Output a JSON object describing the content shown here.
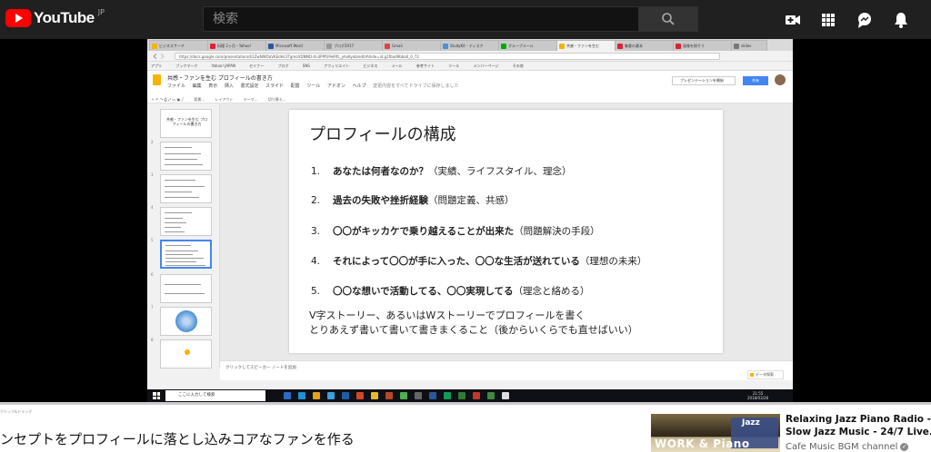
{
  "youtube": {
    "logo_text": "YouTube",
    "region": "JP",
    "search_placeholder": "検索"
  },
  "browser": {
    "tabs": [
      "ビジネスサーチ",
      "料理 2ヶ月・Yahoo!",
      "Microsoft Word",
      "ブログ2017",
      "Gmail",
      "StudyKit - ディスク",
      "グループメール",
      "共感・ファンを生む",
      "集客の基本",
      "画像を探そう",
      "slides"
    ],
    "active_tab": 7,
    "url": "https://docs.google.com/presentation/d/1ZwNWOaVKEdHc3TgmoXDNMD-Xn3PPfUPeIRfL_yhoKyob/edit#slide=id.g1fbad9bba0_0_72",
    "bookmarks": [
      "アプリ",
      "ブックマーク",
      "Yahoo! JAPAN",
      "セミナー",
      "ブログ",
      "SNS",
      "アフィリエイト",
      "ビジネス",
      "メール",
      "参考サイト",
      "ツール",
      "メンバーページ",
      "その他"
    ]
  },
  "doc": {
    "title": "共感・ファンを生む プロフィールの書き方",
    "menu": [
      "ファイル",
      "編集",
      "表示",
      "挿入",
      "書式設定",
      "スライド",
      "配置",
      "ツール",
      "アドオン",
      "ヘルプ"
    ],
    "saved_status": "変更内容をすべてドライブに保存しました",
    "present_label": "プレゼンテーションを開始",
    "share_label": "共有",
    "toolbar": [
      "背景...",
      "レイアウト",
      "テーマ...",
      "切り替え..."
    ]
  },
  "slide": {
    "title": "プロフィールの構成",
    "items": [
      {
        "num": "1.",
        "bold": "あなたは何者なのか？",
        "rest": "（実績、ライフスタイル、理念）"
      },
      {
        "num": "2.",
        "bold": "過去の失敗や挫折経験",
        "rest": "（問題定義、共感）"
      },
      {
        "num": "3.",
        "bold": "〇〇がキッカケで乗り越えることが出来た",
        "rest": "（問題解決の手段）"
      },
      {
        "num": "4.",
        "bold": "それによって〇〇が手に入った、〇〇な生活が送れている",
        "rest": "（理想の未来）"
      },
      {
        "num": "5.",
        "bold": "〇〇な想いで活動してる、〇〇実現してる",
        "rest": "（理念と絡める）"
      }
    ],
    "footer_line1": "V字ストーリー、あるいはWストーリーでプロフィールを書く",
    "footer_line2": "とりあえず書いて書いて書きまくること（後からいくらでも直せばいい）"
  },
  "filmstrip": {
    "first_title": "共感・ファンを生む プロフィールの書き方",
    "slide_numbers": [
      "1",
      "2",
      "3",
      "4",
      "5",
      "6",
      "7",
      "8"
    ],
    "selected": 5
  },
  "notes": {
    "placeholder": "クリックしてスピーカー ノートを追加",
    "explore_label": "データ探索"
  },
  "taskbar": {
    "search_text": "ここに入力して検索",
    "time": "21:55",
    "date": "2018/03/28"
  },
  "player": {
    "progress": 0.0,
    "hint": "クリック&ドラッグ"
  },
  "video": {
    "title": "ンセプトをプロフィールに落とし込みコアなファンを作る"
  },
  "recommended": {
    "thumb_word1": "Jazz",
    "thumb_word2": "WORK & Piano",
    "title_line1": "Relaxing Jazz Piano Radio -",
    "title_line2": "Slow Jazz Music - 24/7 Live...",
    "channel": "Cafe Music BGM channel"
  },
  "colors": {
    "youtube_red": "#ff0000",
    "header_bg": "#202020",
    "slides_yellow": "#f4b400",
    "share_blue": "#4285f4"
  }
}
